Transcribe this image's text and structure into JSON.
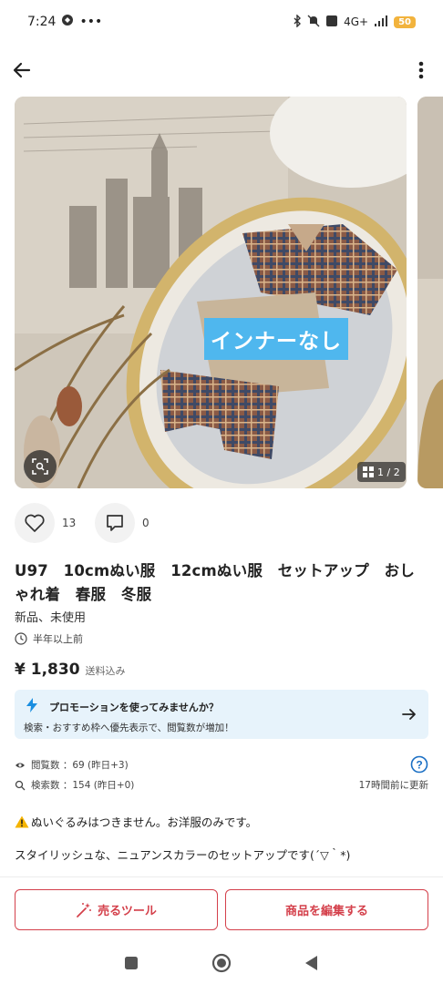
{
  "status_bar": {
    "time": "7:24",
    "network": "4G+",
    "battery": "50"
  },
  "gallery": {
    "overlay_text": "インナーなし",
    "page_indicator": "1 / 2"
  },
  "actions": {
    "like_count": "13",
    "comment_count": "0"
  },
  "item": {
    "title": "U97　10cmぬい服　12cmぬい服　セットアップ　おしゃれ着　春服　冬服",
    "condition": "新品、未使用",
    "posted": "半年以上前",
    "price": "¥ 1,830",
    "price_note": "送料込み"
  },
  "promo": {
    "title": "プロモーションを使ってみませんか？",
    "description": "検索・おすすめ枠へ優先表示で、閲覧数が増加！"
  },
  "stats": {
    "views": "閲覧数 ：69 (昨日+3)",
    "searches": "検索数 ：154 (昨日+0)",
    "updated": "17時間前に更新"
  },
  "description": {
    "line1": "ぬいぐるみはつきません。お洋服のみです。",
    "line2": "スタイリッシュな、ニュアンスカラーのセットアップです(´▽｀*)"
  },
  "bottom": {
    "sell_tools_label": "売るツール",
    "edit_label": "商品を編集する"
  },
  "colors": {
    "accent_red": "#d4404b",
    "promo_bg": "#e7f3fb",
    "overlay_blue": "#4fb7ee",
    "promo_blue": "#1a8ee0"
  }
}
